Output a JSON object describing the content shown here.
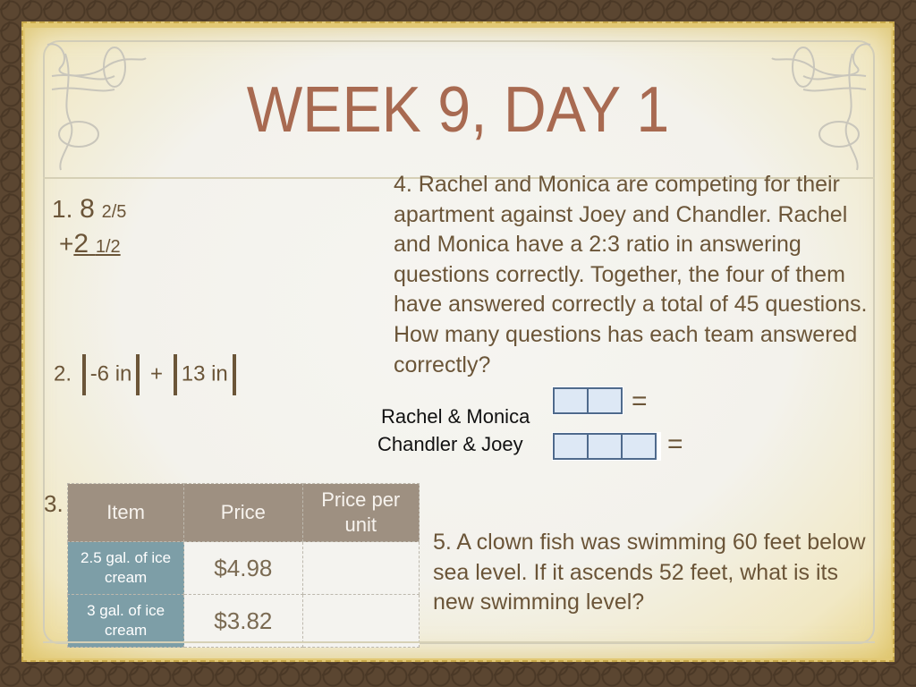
{
  "slide": {
    "title": "WEEK 9, DAY 1",
    "q1": {
      "number": "1.",
      "line1_whole": "8",
      "line1_fraction": "2/5",
      "line2_operator": "+",
      "line2_whole": "2",
      "line2_fraction": "1/2"
    },
    "q2": {
      "number": "2.",
      "term1": "-6 in",
      "operator": "+",
      "term2": "13 in"
    },
    "q3": {
      "number": "3.",
      "table": {
        "headers": [
          "Item",
          "Price",
          "Price per unit"
        ],
        "rows": [
          {
            "item": "2.5 gal. of ice cream",
            "price": "$4.98",
            "unit_price": ""
          },
          {
            "item": "3 gal. of ice cream",
            "price": "$3.82",
            "unit_price": ""
          }
        ]
      }
    },
    "q4": {
      "text": "4. Rachel and Monica are competing for their apartment against Joey and Chandler. Rachel and Monica have a 2:3 ratio in answering questions correctly.  Together, the four of them have answered correctly a total of 45 questions.  How many questions has each team answered correctly?",
      "tape_diagram": [
        {
          "label": "Rachel & Monica",
          "parts": 2,
          "equals": "="
        },
        {
          "label": "Chandler & Joey",
          "parts": 3,
          "equals": "="
        }
      ]
    },
    "q5": {
      "text": "5. A clown fish was swimming 60 feet below sea level.  If it ascends 52 feet, what is its new swimming level?"
    }
  }
}
